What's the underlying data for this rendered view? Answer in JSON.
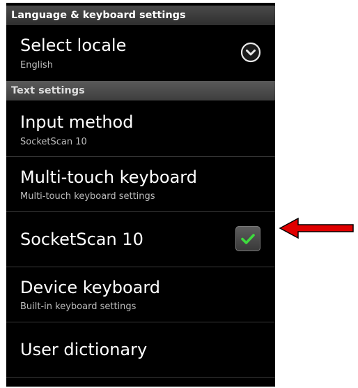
{
  "headers": {
    "language": "Language & keyboard settings",
    "text_settings": "Text settings"
  },
  "items": {
    "select_locale": {
      "title": "Select locale",
      "subtitle": "English"
    },
    "input_method": {
      "title": "Input method",
      "subtitle": "SocketScan 10"
    },
    "multitouch": {
      "title": "Multi-touch keyboard",
      "subtitle": "Multi-touch keyboard settings"
    },
    "socketscan": {
      "title": "SocketScan 10",
      "checked": true
    },
    "device_keyboard": {
      "title": "Device keyboard",
      "subtitle": "Built-in keyboard settings"
    },
    "user_dictionary": {
      "title": "User dictionary"
    }
  },
  "icons": {
    "locale_dropdown": "chevron-down-circle-icon",
    "socketscan_check": "checkmark-icon",
    "annotation": "red-arrow-icon"
  },
  "colors": {
    "check_green": "#3ddc3d",
    "arrow_red": "#e00000"
  }
}
